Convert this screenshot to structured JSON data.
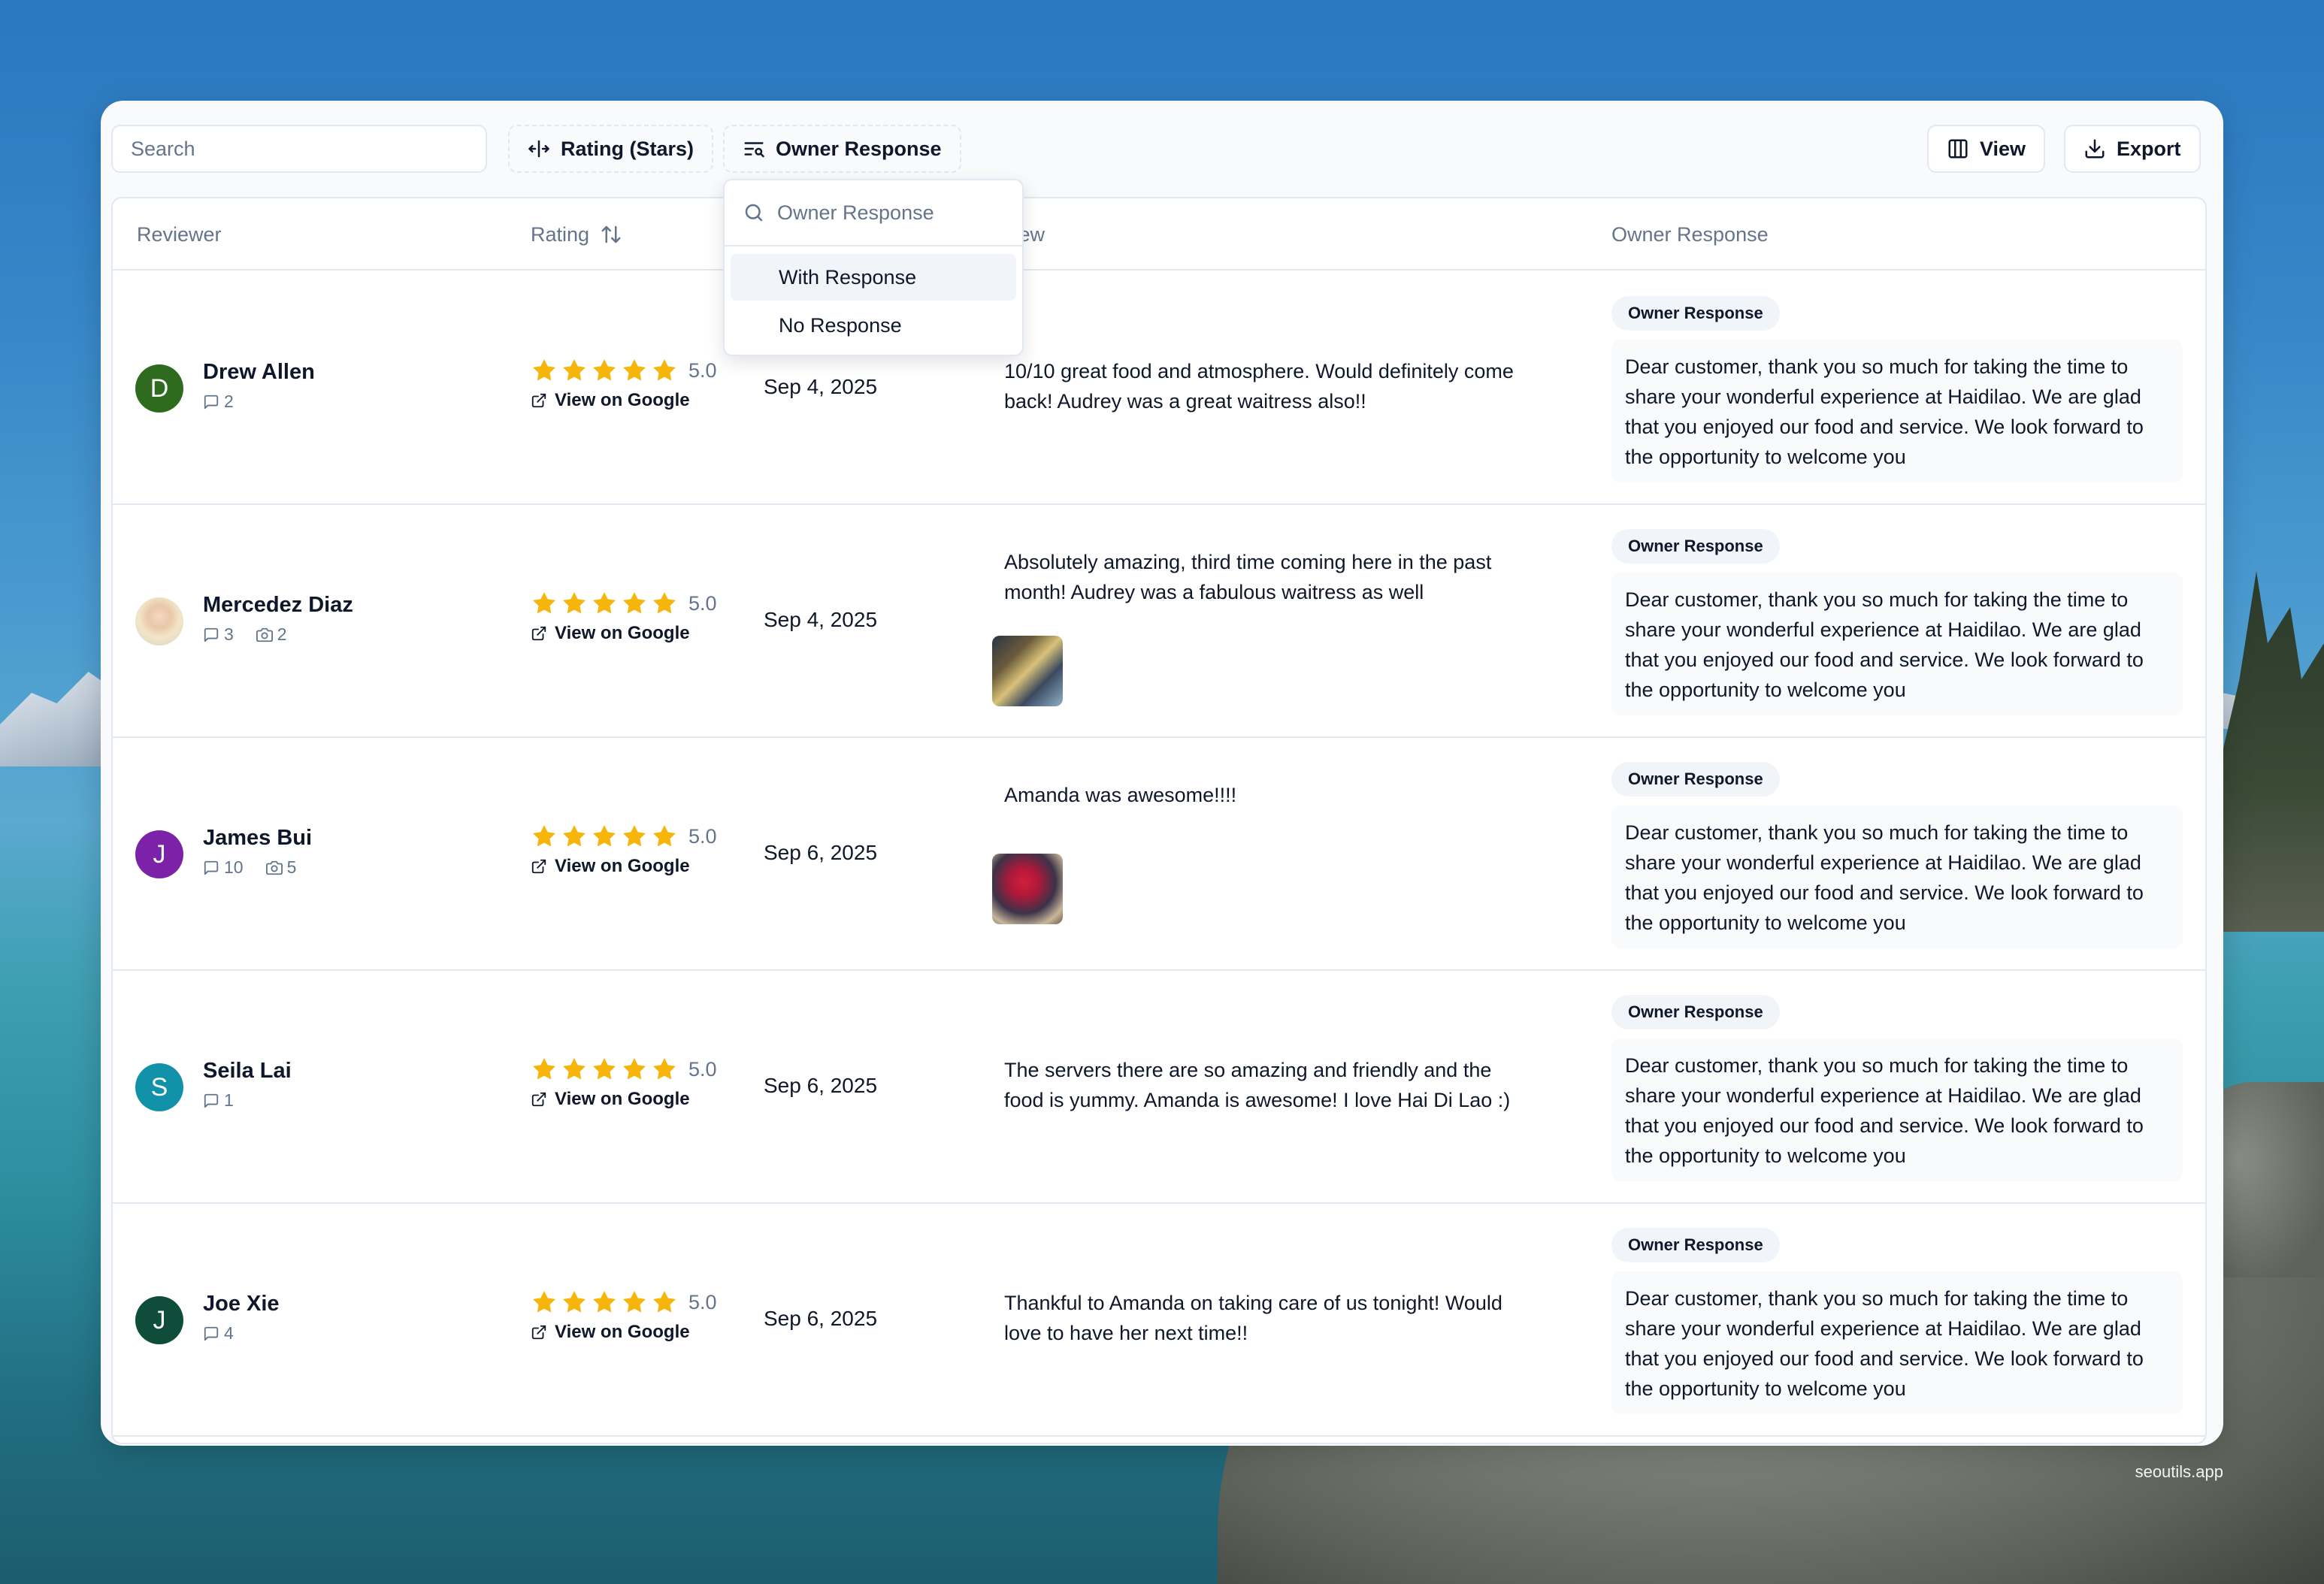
{
  "toolbar": {
    "search_placeholder": "Search",
    "rating_filter_label": "Rating (Stars)",
    "owner_response_filter_label": "Owner Response",
    "view_label": "View",
    "export_label": "Export"
  },
  "table": {
    "headers": {
      "reviewer": "Reviewer",
      "rating": "Rating",
      "review": "view",
      "owner_response": "Owner Response"
    }
  },
  "dropdown": {
    "placeholder": "Owner Response",
    "options": [
      "With Response",
      "No Response"
    ],
    "highlighted": "With Response"
  },
  "rows": [
    {
      "avatar_letter": "D",
      "avatar_color": "#2f6b1f",
      "name": "Drew Allen",
      "comments": "2",
      "photos": "",
      "rating": 5,
      "score": "5.0",
      "view_link": "View on Google",
      "date": "Sep 4, 2025",
      "review": "10/10 great food and atmosphere. Would definitely come back! Audrey was a great waitress also!!",
      "badge": "Owner Response",
      "response": "Dear customer, thank you so much for taking the time to share your wonderful experience at Haidilao. We are glad that you enjoyed our food and service. We look forward to the opportunity to welcome you"
    },
    {
      "avatar_letter": "",
      "avatar_color": "#e9c7aa",
      "name": "Mercedez Diaz",
      "comments": "3",
      "photos": "2",
      "rating": 5,
      "score": "5.0",
      "view_link": "View on Google",
      "date": "Sep 4, 2025",
      "review": "Absolutely amazing, third time coming here in the past month! Audrey was a fabulous waitress as well",
      "badge": "Owner Response",
      "response": "Dear customer, thank you so much for taking the time to share your wonderful experience at Haidilao. We are glad that you enjoyed our food and service. We look forward to the opportunity to welcome you"
    },
    {
      "avatar_letter": "J",
      "avatar_color": "#7b22a8",
      "name": "James Bui",
      "comments": "10",
      "photos": "5",
      "rating": 5,
      "score": "5.0",
      "view_link": "View on Google",
      "date": "Sep 6, 2025",
      "review": "Amanda was awesome!!!!",
      "badge": "Owner Response",
      "response": "Dear customer, thank you so much for taking the time to share your wonderful experience at Haidilao. We are glad that you enjoyed our food and service. We look forward to the opportunity to welcome you"
    },
    {
      "avatar_letter": "S",
      "avatar_color": "#1292a8",
      "name": "Seila Lai",
      "comments": "1",
      "photos": "",
      "rating": 5,
      "score": "5.0",
      "view_link": "View on Google",
      "date": "Sep 6, 2025",
      "review": "The servers there are so amazing and friendly and the food is yummy. Amanda is awesome! I love Hai Di Lao :)",
      "badge": "Owner Response",
      "response": "Dear customer, thank you so much for taking the time to share your wonderful experience at Haidilao. We are glad that you enjoyed our food and service. We look forward to the opportunity to welcome you"
    },
    {
      "avatar_letter": "J",
      "avatar_color": "#0f4d3a",
      "name": "Joe Xie",
      "comments": "4",
      "photos": "",
      "rating": 5,
      "score": "5.0",
      "view_link": "View on Google",
      "date": "Sep 6, 2025",
      "review": "Thankful to Amanda on taking care of us tonight! Would love to have her next time!!",
      "badge": "Owner Response",
      "response": "Dear customer, thank you so much for taking the time to share your wonderful experience at Haidilao. We are glad that you enjoyed our food and service. We look forward to the opportunity to welcome you"
    }
  ],
  "colors": {
    "star": "#f5b50a",
    "text": "#0f172a",
    "muted": "#64748b",
    "border": "#e2e8f0"
  },
  "watermark": "seoutils.app"
}
